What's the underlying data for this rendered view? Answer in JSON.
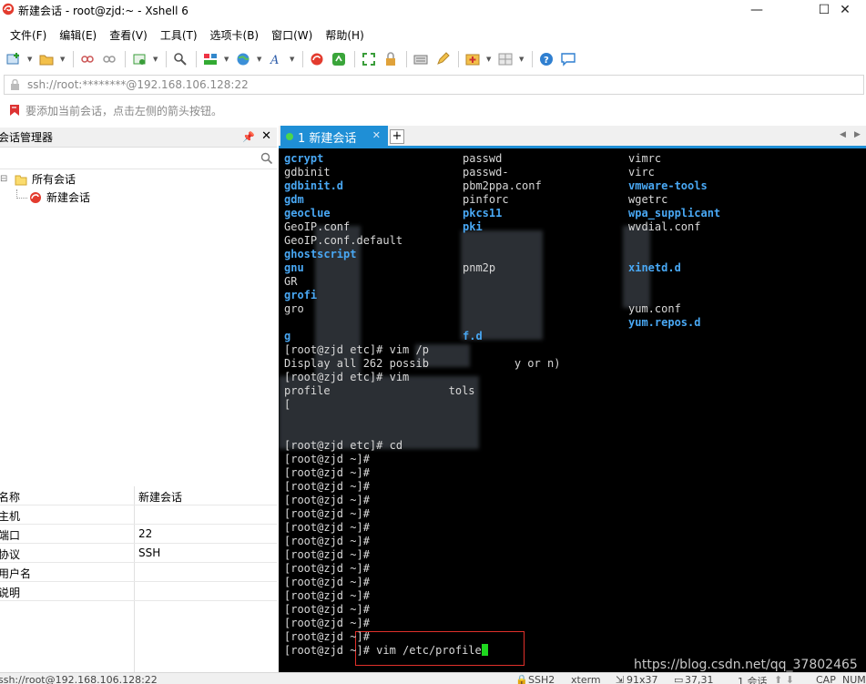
{
  "window": {
    "title": "新建会话 - root@zjd:~ - Xshell 6",
    "minimize": "—",
    "maximize": "☐",
    "close": "✕"
  },
  "menu": [
    "文件(F)",
    "编辑(E)",
    "查看(V)",
    "工具(T)",
    "选项卡(B)",
    "窗口(W)",
    "帮助(H)"
  ],
  "address": {
    "text": "ssh://root:********@192.168.106.128:22"
  },
  "hint": {
    "text": "要添加当前会话，点击左侧的箭头按钮。"
  },
  "session_manager": {
    "title": "会话管理器",
    "tree": {
      "root": "所有会话",
      "child": "新建会话"
    },
    "properties": [
      {
        "key": "名称",
        "value": "新建会话"
      },
      {
        "key": "主机",
        "value": ""
      },
      {
        "key": "端口",
        "value": "22"
      },
      {
        "key": "协议",
        "value": "SSH"
      },
      {
        "key": "用户名",
        "value": ""
      },
      {
        "key": "说明",
        "value": ""
      }
    ]
  },
  "tab": {
    "label": "1 新建会话"
  },
  "terminal": {
    "lines": [
      {
        "cols": [
          [
            "gcrypt",
            "dir"
          ],
          [
            "passwd",
            ""
          ],
          [
            "vimrc",
            ""
          ]
        ]
      },
      {
        "cols": [
          [
            "gdbinit",
            ""
          ],
          [
            "passwd-",
            ""
          ],
          [
            "virc",
            ""
          ]
        ]
      },
      {
        "cols": [
          [
            "gdbinit.d",
            "dir"
          ],
          [
            "pbm2ppa.conf",
            ""
          ],
          [
            "vmware-tools",
            "dir"
          ]
        ]
      },
      {
        "cols": [
          [
            "gdm",
            "dir"
          ],
          [
            "pinforc",
            ""
          ],
          [
            "wgetrc",
            ""
          ]
        ]
      },
      {
        "cols": [
          [
            "geoclue",
            "dir"
          ],
          [
            "pkcs11",
            "dir"
          ],
          [
            "wpa_supplicant",
            "dir"
          ]
        ]
      },
      {
        "cols": [
          [
            "GeoIP.conf",
            ""
          ],
          [
            "pki",
            "dir"
          ],
          [
            "wvdial.conf",
            ""
          ]
        ]
      },
      {
        "cols": [
          [
            "GeoIP.conf.default",
            ""
          ],
          [
            "",
            ""
          ],
          [
            "",
            ""
          ]
        ]
      },
      {
        "cols": [
          [
            "ghostscript",
            "dir"
          ],
          [
            "",
            ""
          ],
          [
            "",
            ""
          ]
        ]
      },
      {
        "cols": [
          [
            "gnu",
            "dir"
          ],
          [
            "pnm2p",
            ""
          ],
          [
            "xinetd.d",
            "dir"
          ]
        ]
      },
      {
        "cols": [
          [
            "GR",
            ""
          ],
          [
            "",
            ""
          ],
          [
            "",
            ""
          ]
        ]
      },
      {
        "cols": [
          [
            "grofi",
            "dir"
          ],
          [
            "",
            ""
          ],
          [
            "",
            ""
          ]
        ]
      },
      {
        "cols": [
          [
            "gro",
            ""
          ],
          [
            "",
            ""
          ],
          [
            "yum.conf",
            ""
          ]
        ]
      },
      {
        "cols": [
          [
            "",
            ""
          ],
          [
            "",
            ""
          ],
          [
            "yum.repos.d",
            "dir"
          ]
        ]
      },
      {
        "cols": [
          [
            "g",
            "dir"
          ],
          [
            "f.d",
            "dir"
          ],
          [
            "",
            ""
          ]
        ]
      },
      {
        "text": "[root@zjd etc]# vim /p"
      },
      {
        "text": "Display all 262 possib             y or n)"
      },
      {
        "text": "[root@zjd etc]# vim"
      },
      {
        "text": "profile                  tols"
      },
      {
        "text": "["
      },
      {
        "text": ""
      },
      {
        "text": ""
      },
      {
        "text": "[root@zjd etc]# cd"
      },
      {
        "text": "[root@zjd ~]#"
      },
      {
        "text": "[root@zjd ~]#"
      },
      {
        "text": "[root@zjd ~]#"
      },
      {
        "text": "[root@zjd ~]#"
      },
      {
        "text": "[root@zjd ~]#"
      },
      {
        "text": "[root@zjd ~]#"
      },
      {
        "text": "[root@zjd ~]#"
      },
      {
        "text": "[root@zjd ~]#"
      },
      {
        "text": "[root@zjd ~]#"
      },
      {
        "text": "[root@zjd ~]#"
      },
      {
        "text": "[root@zjd ~]#"
      },
      {
        "text": "[root@zjd ~]#"
      },
      {
        "text": "[root@zjd ~]#"
      },
      {
        "text": "[root@zjd ~]#"
      },
      {
        "text": "[root@zjd ~]# vim /etc/profile",
        "cursor": true
      }
    ],
    "watermark": "https://blog.csdn.net/qq_37802465"
  },
  "status": {
    "connection": "ssh://root@192.168.106.128:22",
    "protocol": "SSH2",
    "term": "xterm",
    "size": "91x37",
    "position": "37,31",
    "sessions": "1 会话",
    "caps": "CAP",
    "num": "NUM"
  },
  "colors": {
    "accent": "#1f8fd6",
    "dir": "#49a8f4",
    "cursor": "#1fd81f",
    "highlight": "#e0302a"
  }
}
